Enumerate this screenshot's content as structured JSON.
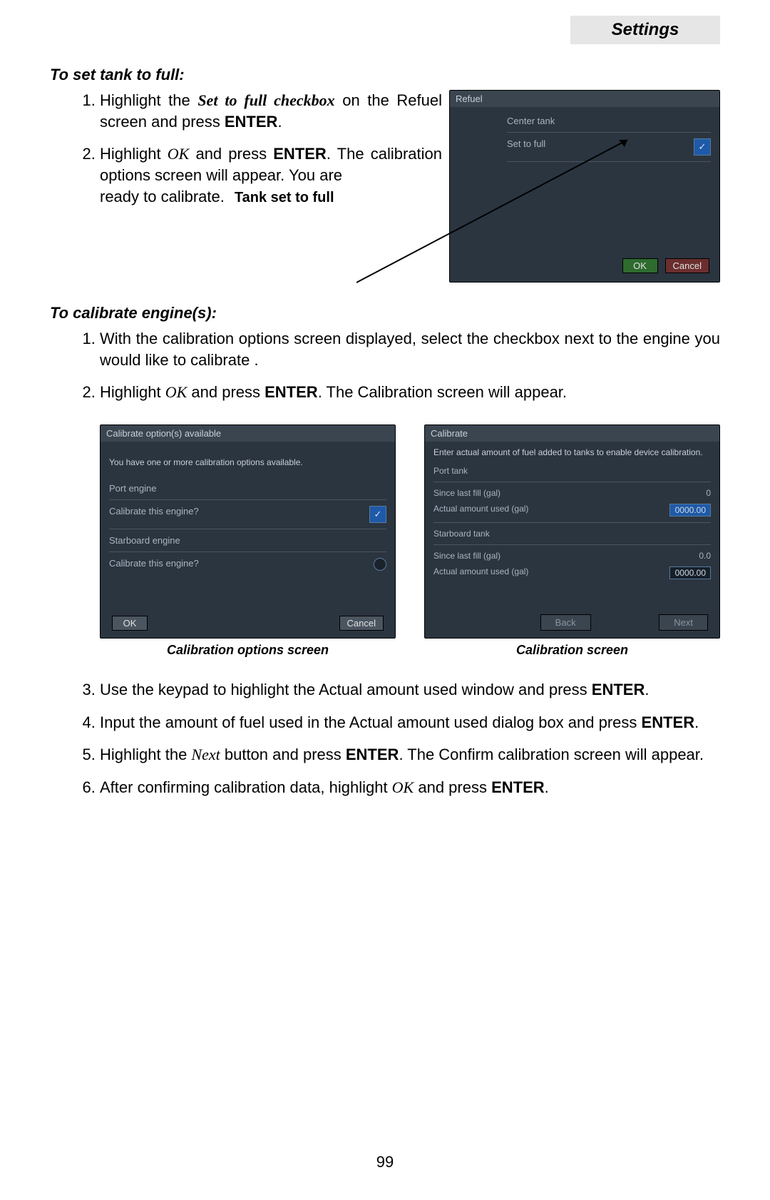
{
  "tab": "Settings",
  "section1": {
    "heading": "To set tank to full:",
    "step1_a": "Highlight the ",
    "step1_b": "Set to full checkbox",
    "step1_c": " on the Refuel screen and press ",
    "step1_d": "ENTER",
    "step1_e": ".",
    "step2_a": "Highlight ",
    "step2_b": "OK",
    "step2_c": " and press ",
    "step2_d": "ENTER",
    "step2_e": ". The calibration options screen will appear. You are",
    "step2_f": "ready to calibrate.",
    "callout": "Tank set to full"
  },
  "refuel_dev": {
    "title": "Refuel",
    "row1": "Center tank",
    "row2": "Set to full",
    "ok": "OK",
    "cancel": "Cancel"
  },
  "section2": {
    "heading": "To calibrate engine(s):",
    "step1": "With the calibration options screen displayed, select the checkbox next to the engine you would like to calibrate .",
    "step2_a": "Highlight ",
    "step2_b": "OK",
    "step2_c": " and press ",
    "step2_d": "ENTER",
    "step2_e": ". The Calibration screen will appear."
  },
  "shotA": {
    "title": "Calibrate option(s) available",
    "msg": "You have one or more calibration options available.",
    "port": "Port engine",
    "q": "Calibrate this engine?",
    "stbd": "Starboard engine",
    "ok": "OK",
    "cancel": "Cancel",
    "caption": "Calibration options screen"
  },
  "shotB": {
    "title": "Calibrate",
    "msg": "Enter actual amount of fuel added to tanks to enable device calibration.",
    "portTank": "Port tank",
    "since": "Since last fill (gal)",
    "actual": "Actual amount used (gal)",
    "stbdTank": "Starboard tank",
    "v_port_since": "0",
    "v_port_actual": "0000.00",
    "v_stbd_since": "0.0",
    "v_stbd_actual": "0000.00",
    "back": "Back",
    "next": "Next",
    "caption": "Calibration screen"
  },
  "section3": {
    "step3_a": "Use the keypad to highlight the Actual amount used window and press ",
    "step3_b": "ENTER",
    "step3_c": ".",
    "step4_a": "Input the amount of fuel used in the Actual amount used dialog box and press ",
    "step4_b": "ENTER",
    "step4_c": ".",
    "step5_a": "Highlight the ",
    "step5_b": "Next",
    "step5_c": " button and press ",
    "step5_d": "ENTER",
    "step5_e": ". The Confirm calibration screen will appear.",
    "step6_a": "After confirming calibration data, highlight ",
    "step6_b": "OK",
    "step6_c": " and press ",
    "step6_d": "ENTER",
    "step6_e": "."
  },
  "pageNumber": "99"
}
